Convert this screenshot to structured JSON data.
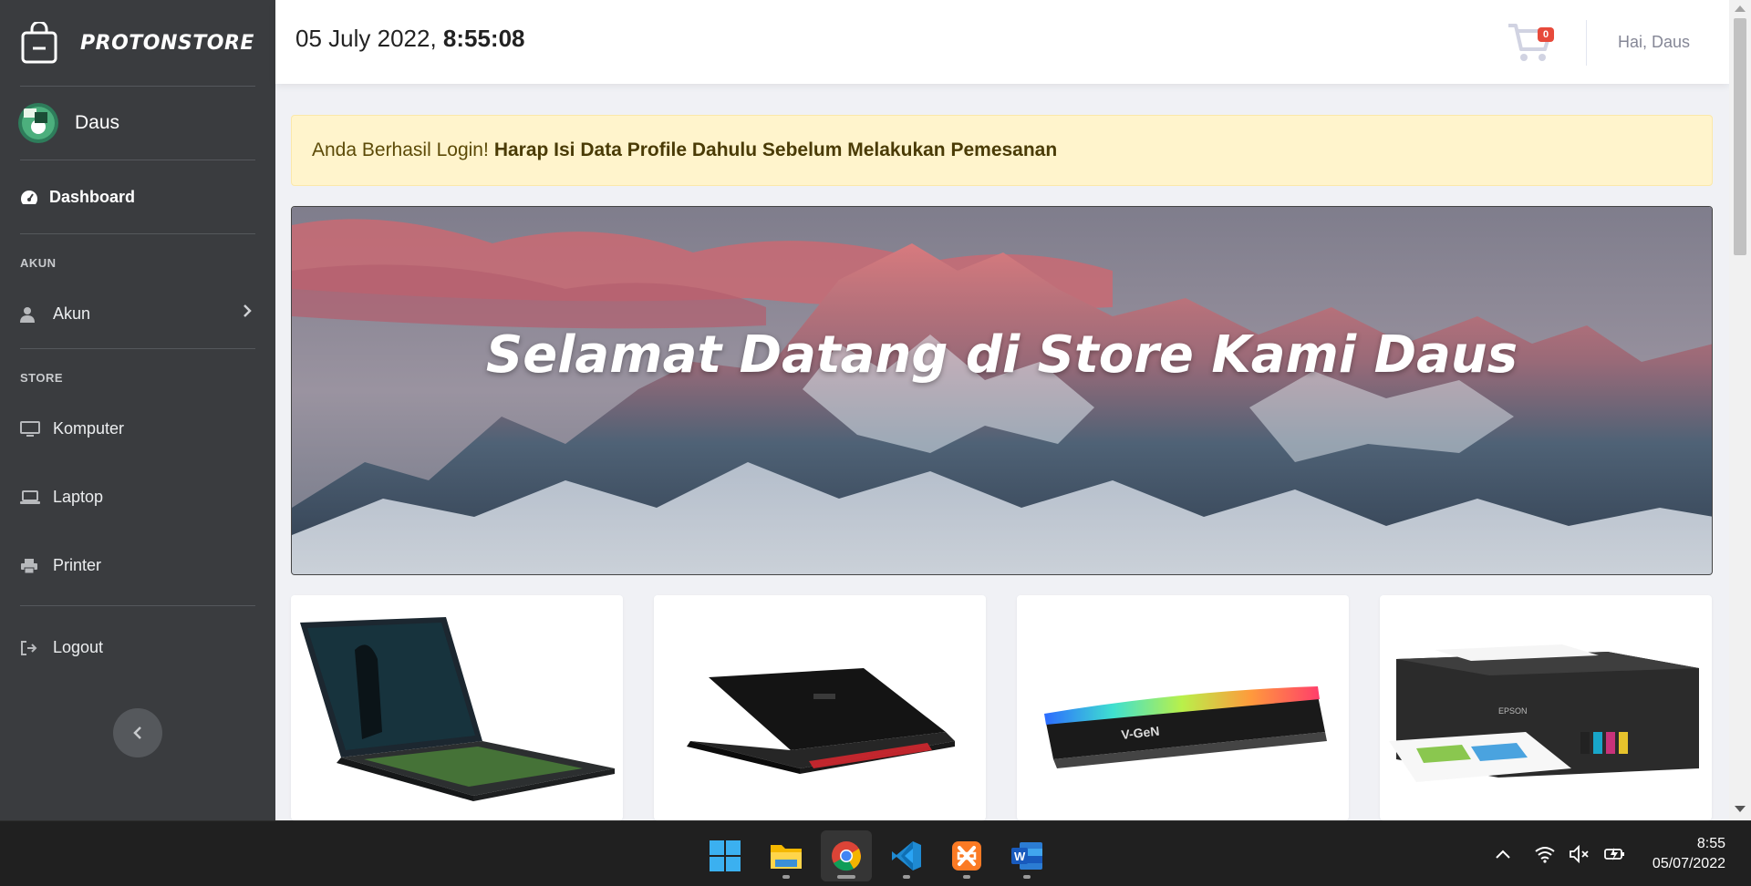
{
  "sidebar": {
    "brand": "PROTONSTORE",
    "user_name": "Daus",
    "dashboard_label": "Dashboard",
    "section_akun": "AKUN",
    "akun_label": "Akun",
    "section_store": "STORE",
    "items": [
      {
        "label": "Komputer",
        "icon": "desktop-icon"
      },
      {
        "label": "Laptop",
        "icon": "laptop-icon"
      },
      {
        "label": "Printer",
        "icon": "printer-icon"
      }
    ],
    "logout_label": "Logout"
  },
  "topbar": {
    "date": "05 July 2022, ",
    "time": "8:55:08",
    "cart_count": "0",
    "greeting": "Hai, Daus"
  },
  "alert": {
    "text": "Anda Berhasil Login!",
    "bold": "Harap Isi Data Profile Dahulu Sebelum Melakukan Pemesanan"
  },
  "banner": {
    "welcome": "Selamat Datang di Store Kami ",
    "name": "Daus"
  },
  "products": [
    {
      "name": "hp-gaming-laptop"
    },
    {
      "name": "acer-laptop"
    },
    {
      "name": "vgen-ram"
    },
    {
      "name": "epson-printer"
    }
  ],
  "taskbar": {
    "apps": [
      "start",
      "file-explorer",
      "chrome",
      "vscode",
      "xampp",
      "word"
    ],
    "clock_time": "8:55",
    "clock_date": "05/07/2022"
  },
  "colors": {
    "sidebar": "#3a3c3f",
    "alert_bg": "#fff4cc",
    "badge": "#e74a3b"
  }
}
